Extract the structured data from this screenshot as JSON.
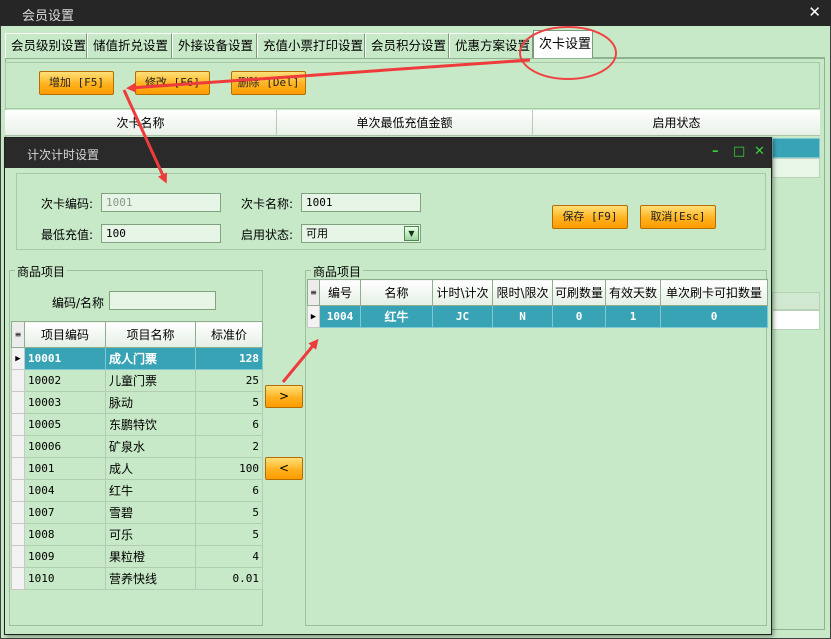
{
  "outer": {
    "title": "会员设置",
    "close": "✕",
    "tabs": [
      "会员级别设置",
      "储值折兑设置",
      "外接设备设置",
      "充值小票打印设置",
      "会员积分设置",
      "优惠方案设置",
      "次卡设置"
    ],
    "toolbar": {
      "add": "增加 [F5]",
      "edit": "修改 [F6]",
      "delete": "删除 [Del]"
    },
    "grid_headers": [
      "次卡名称",
      "单次最低充值金额",
      "启用状态"
    ]
  },
  "dialog": {
    "title": "计次计时设置",
    "controls": {
      "minimize": "–",
      "maximize": "□",
      "close": "✕"
    },
    "form": {
      "card_code_label": "次卡编码:",
      "card_code_value": "1001",
      "card_name_label": "次卡名称:",
      "card_name_value": "1001",
      "min_charge_label": "最低充值:",
      "min_charge_value": "100",
      "status_label": "启用状态:",
      "status_value": "可用",
      "save": "保存 [F9]",
      "cancel": "取消[Esc]"
    },
    "left": {
      "group_title": "商品项目",
      "search_label": "编码/名称",
      "search_value": "",
      "headers": [
        "项目编码",
        "项目名称",
        "标准价"
      ],
      "rows": [
        [
          "10001",
          "成人门票",
          "128"
        ],
        [
          "10002",
          "儿童门票",
          "25"
        ],
        [
          "10003",
          "脉动",
          "5"
        ],
        [
          "10005",
          "东鹏特饮",
          "6"
        ],
        [
          "10006",
          "矿泉水",
          "2"
        ],
        [
          "1001",
          "成人",
          "100"
        ],
        [
          "1004",
          "红牛",
          "6"
        ],
        [
          "1007",
          "雪碧",
          "5"
        ],
        [
          "1008",
          "可乐",
          "5"
        ],
        [
          "1009",
          "果粒橙",
          "4"
        ],
        [
          "1010",
          "营养快线",
          "0.01"
        ]
      ]
    },
    "move_right": ">",
    "move_left": "<",
    "right": {
      "group_title": "商品项目",
      "headers": [
        "编号",
        "名称",
        "计时\\计次",
        "限时\\限次",
        "可刷数量",
        "有效天数",
        "单次刷卡可扣数量"
      ],
      "rows": [
        [
          "1004",
          "红牛",
          "JC",
          "N",
          "0",
          "1",
          "0"
        ]
      ]
    }
  }
}
